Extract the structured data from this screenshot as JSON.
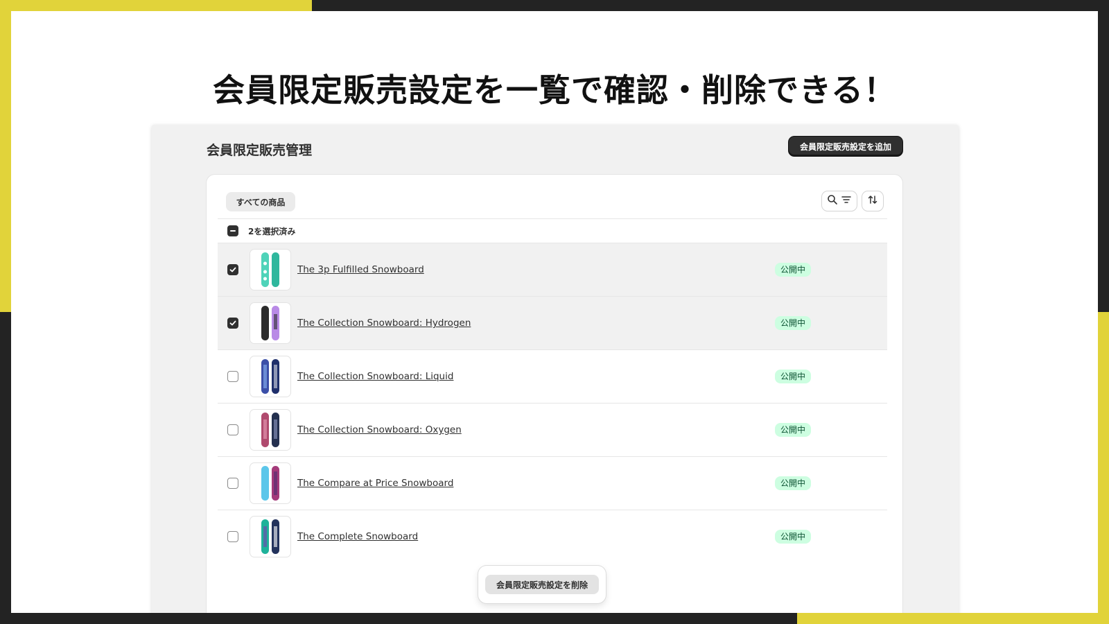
{
  "headline": "会員限定販売設定を一覧で確認・削除できる！",
  "page": {
    "title": "会員限定販売管理",
    "add_button": "会員限定販売設定を追加"
  },
  "toolbar": {
    "tab_all": "すべての商品",
    "search_filter_icon": "search-filter-icon",
    "sort_icon": "sort-icon"
  },
  "bulk": {
    "selected_label": "2を選択済み"
  },
  "products": [
    {
      "name": "The 3p Fulfilled Snowboard",
      "status": "公開中",
      "selected": true,
      "colors": [
        "#4fd3b9",
        "#2fb79d"
      ]
    },
    {
      "name": "The Collection Snowboard: Hydrogen",
      "status": "公開中",
      "selected": true,
      "colors": [
        "#2b2b2b",
        "#b98ae6"
      ]
    },
    {
      "name": "The Collection Snowboard: Liquid",
      "status": "公開中",
      "selected": false,
      "colors": [
        "#3b4fa8",
        "#1f2f6b"
      ]
    },
    {
      "name": "The Collection Snowboard: Oxygen",
      "status": "公開中",
      "selected": false,
      "colors": [
        "#b04a6e",
        "#24304f"
      ]
    },
    {
      "name": "The Compare at Price Snowboard",
      "status": "公開中",
      "selected": false,
      "colors": [
        "#5cc6ea",
        "#a43a7a"
      ]
    },
    {
      "name": "The Complete Snowboard",
      "status": "公開中",
      "selected": false,
      "colors": [
        "#1fb29a",
        "#23325c"
      ]
    }
  ],
  "action_bar": {
    "delete_button": "会員限定販売設定を削除"
  },
  "colors": {
    "accent_yellow": "#e1d33a",
    "background_dark": "#232323",
    "badge_bg": "#cdfee1",
    "badge_text": "#0c5132"
  }
}
